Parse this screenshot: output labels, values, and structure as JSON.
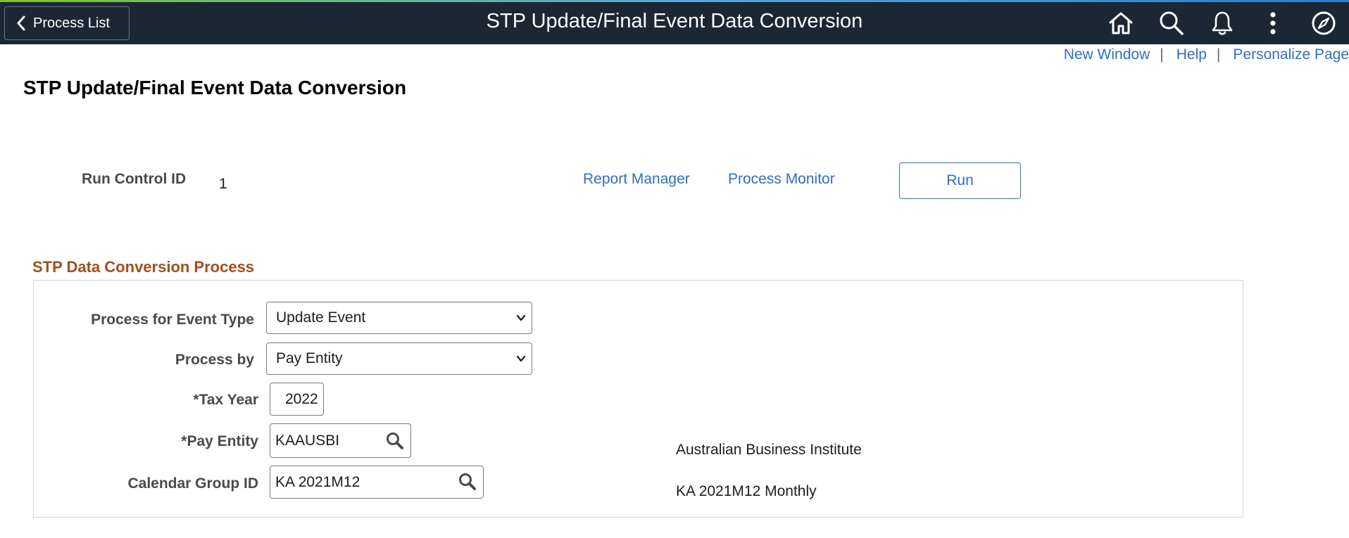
{
  "banner": {
    "back_label": "Process List",
    "title": "STP Update/Final Event Data Conversion",
    "icons": [
      "home-icon",
      "search-icon",
      "notification-bell-icon",
      "actions-menu-icon",
      "navbar-compass-icon"
    ]
  },
  "top_links": {
    "new_window": "New Window",
    "help": "Help",
    "personalize": "Personalize Page",
    "separator": "|"
  },
  "page_title": "STP Update/Final Event Data Conversion",
  "run_control": {
    "label": "Run Control ID",
    "value": "1",
    "report_manager": "Report Manager",
    "process_monitor": "Process Monitor",
    "run_label": "Run"
  },
  "section": {
    "title": "STP Data Conversion Process",
    "event_type": {
      "label": "Process for Event Type",
      "value": "Update Event"
    },
    "process_by": {
      "label": "Process by",
      "value": "Pay Entity"
    },
    "tax_year": {
      "label": "*Tax Year",
      "value": "2022"
    },
    "pay_entity": {
      "label": "*Pay Entity",
      "value": "KAAUSBI",
      "description": "Australian Business Institute"
    },
    "calendar_group": {
      "label": "Calendar Group ID",
      "value": "KA 2021M12",
      "description": "KA 2021M12 Monthly"
    }
  },
  "colors": {
    "banner": "#1b2735",
    "link": "#2f6fbf",
    "section_title": "#a0501f"
  }
}
